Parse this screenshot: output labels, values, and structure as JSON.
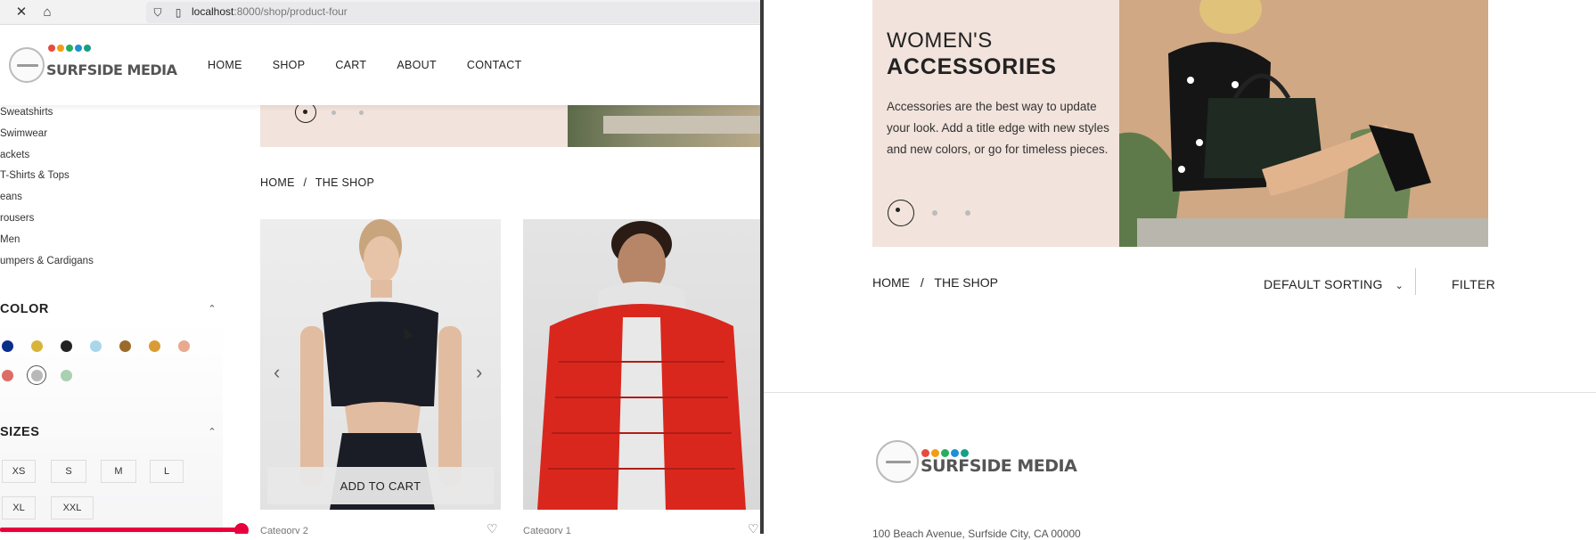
{
  "browser": {
    "url_host": "localhost",
    "url_path": ":8000/shop/product-four",
    "close_icon": "close-icon",
    "home_icon": "home-icon",
    "shield_icon": "shield-icon",
    "page_icon": "page-icon"
  },
  "logo": {
    "text": "SURFSIDE MEDIA",
    "dot_colors": [
      "#e64c3c",
      "#f39c12",
      "#27ae60",
      "#1f8fd6",
      "#16a085"
    ]
  },
  "nav": {
    "items": [
      "HOME",
      "SHOP",
      "CART",
      "ABOUT",
      "CONTACT"
    ]
  },
  "sidebar": {
    "categories": [
      "Sweatshirts",
      "Swimwear",
      "ackets",
      "T-Shirts & Tops",
      "eans",
      "rousers",
      "Men",
      "umpers & Cardigans"
    ],
    "color_heading": "COLOR",
    "colors": [
      "#0a2f8a",
      "#d8b43b",
      "#222222",
      "#a9d6ea",
      "#9a6b2c",
      "#d99c34",
      "#e8a98e",
      "#dc6d64",
      "#b8b8b8",
      "#a9d0b1"
    ],
    "selected_color": "#b8b8b8",
    "sizes_heading": "SIZES",
    "sizes": [
      "XS",
      "S",
      "M",
      "L",
      "XL",
      "XXL"
    ]
  },
  "left_breadcrumb": {
    "home": "HOME",
    "sep": "/",
    "current": "THE SHOP"
  },
  "products": [
    {
      "add_to_cart": "ADD TO CART",
      "category": "Category 2"
    },
    {
      "category": "Category 1"
    }
  ],
  "slider": {
    "prev_icon": "chevron-left-icon",
    "next_icon": "chevron-right-icon"
  },
  "right": {
    "banner_title_line1": "WOMEN'S",
    "banner_title_line2": "ACCESSORIES",
    "banner_desc": "Accessories are the best way to update your look. Add a title edge with new styles and new colors, or go for timeless pieces.",
    "breadcrumb": {
      "home": "HOME",
      "sep": "/",
      "current": "THE SHOP"
    },
    "sort_label": "DEFAULT SORTING",
    "filter_label": "FILTER",
    "address": "100 Beach Avenue, Surfside City, CA 00000"
  }
}
